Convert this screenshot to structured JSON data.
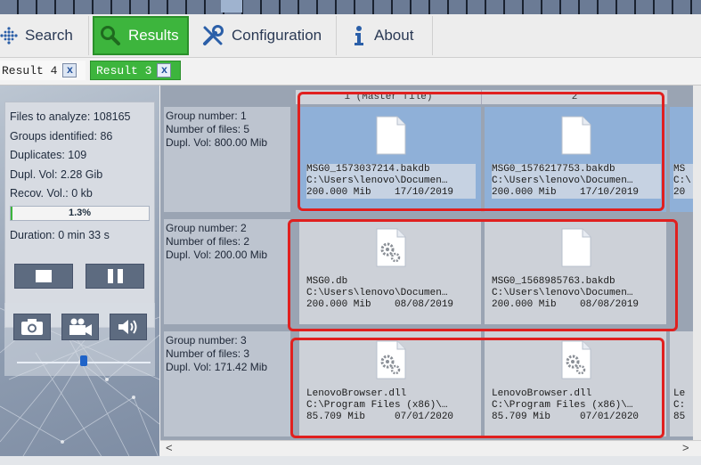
{
  "nav": {
    "items": [
      {
        "label": "Search",
        "icon": "search-dots-icon"
      },
      {
        "label": "Results",
        "icon": "magnifier-icon",
        "active": true
      },
      {
        "label": "Configuration",
        "icon": "tools-icon"
      },
      {
        "label": "About",
        "icon": "info-icon"
      }
    ]
  },
  "result_tabs": [
    {
      "label": "Result 4",
      "close": "x",
      "active": false
    },
    {
      "label": "Result 3",
      "close": "x",
      "active": true
    }
  ],
  "stats": {
    "files_to_analyze": "Files to analyze: 108165",
    "groups_identified": "Groups identified: 86",
    "duplicates": "Duplicates: 109",
    "dupl_vol": "Dupl. Vol: 2.28 Gib",
    "recov_vol": "Recov. Vol.: 0 kb",
    "progress_label": "1.3%",
    "progress_fraction": 0.013,
    "duration": "Duration: 0 min  33 s"
  },
  "media": {
    "volume_fraction": 0.5
  },
  "columns": [
    {
      "label": "1 (Master file)"
    },
    {
      "label": "2"
    }
  ],
  "groups": [
    {
      "number": "Group number: 1",
      "files": "Number of files: 5",
      "dupl": "Dupl. Vol: 800.00 Mib",
      "selected": true,
      "cells": [
        {
          "icon": "document-icon",
          "line1": "MSG0_1573037214.bakdb",
          "line2": "C:\\Users\\lenovo\\Documen…",
          "line3": "200.000 Mib    17/10/2019"
        },
        {
          "icon": "document-icon",
          "line1": "MSG0_1576217753.bakdb",
          "line2": "C:\\Users\\lenovo\\Documen…",
          "line3": "200.000 Mib    17/10/2019"
        }
      ],
      "extra": "MS\nC:\\\n20"
    },
    {
      "number": "Group number: 2",
      "files": "Number of files: 2",
      "dupl": "Dupl. Vol: 200.00 Mib",
      "selected": false,
      "cells": [
        {
          "icon": "gear-document-icon",
          "line1": "MSG0.db",
          "line2": "C:\\Users\\lenovo\\Documen…",
          "line3": "200.000 Mib    08/08/2019"
        },
        {
          "icon": "document-icon",
          "line1": "MSG0_1568985763.bakdb",
          "line2": "C:\\Users\\lenovo\\Documen…",
          "line3": "200.000 Mib    08/08/2019"
        }
      ],
      "extra": ""
    },
    {
      "number": "Group number: 3",
      "files": "Number of files: 3",
      "dupl": "Dupl. Vol: 171.42 Mib",
      "selected": false,
      "cells": [
        {
          "icon": "gear-document-icon",
          "line1": "LenovoBrowser.dll",
          "line2": "C:\\Program Files (x86)\\…",
          "line3": "85.709 Mib     07/01/2020"
        },
        {
          "icon": "gear-document-icon",
          "line1": "LenovoBrowser.dll",
          "line2": "C:\\Program Files (x86)\\…",
          "line3": "85.709 Mib     07/01/2020"
        }
      ],
      "extra": "Le\nC:\n85"
    }
  ],
  "scroll": {
    "left_arrow": "<",
    "right_arrow": ">"
  },
  "colors": {
    "accent": "#3db53d",
    "selected": "#8fb0d8",
    "highlight": "#e0201f"
  }
}
